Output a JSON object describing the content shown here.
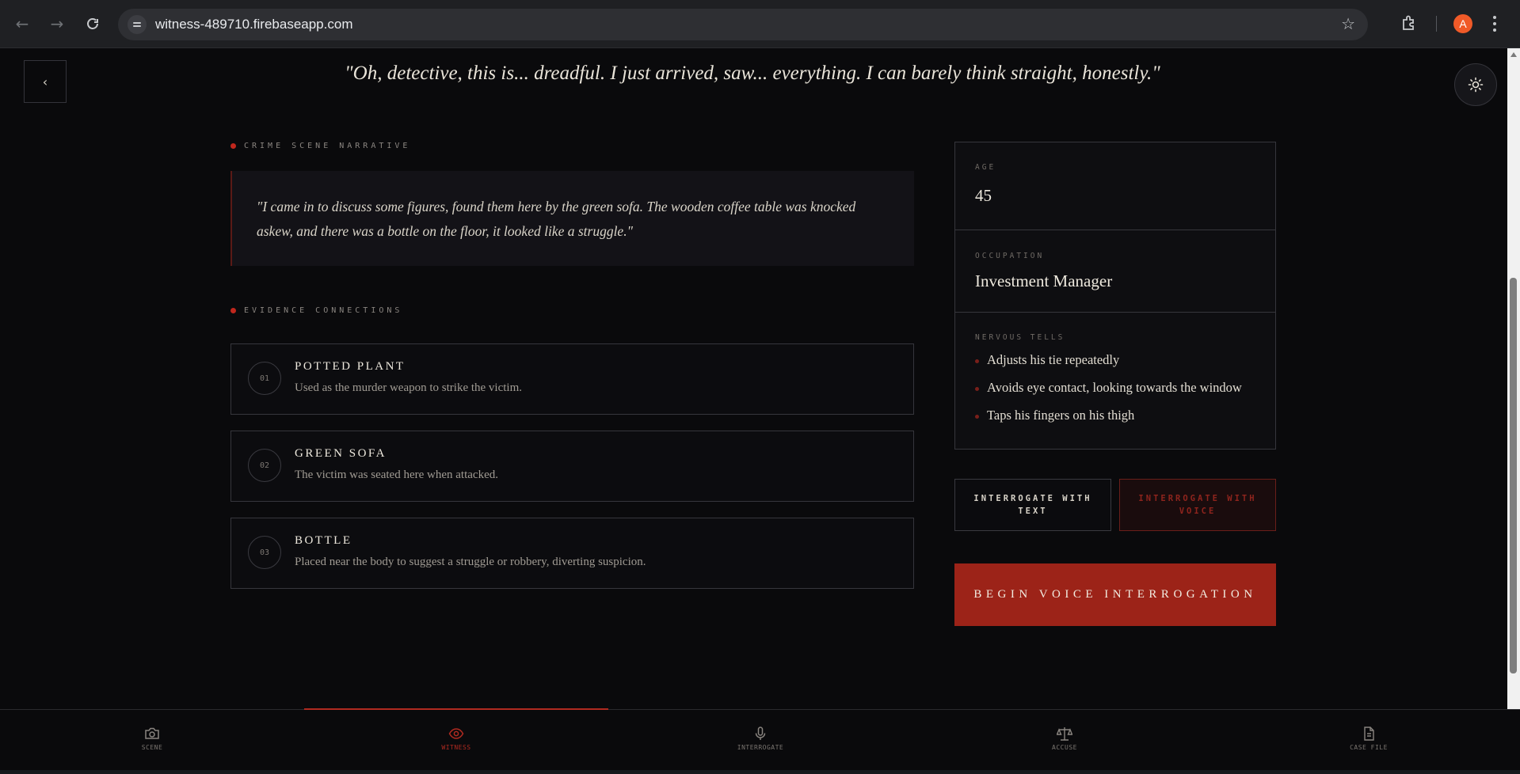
{
  "browser": {
    "url": "witness-489710.firebaseapp.com",
    "avatar_letter": "A"
  },
  "page": {
    "quote": "\"Oh, detective, this is... dreadful. I just arrived, saw... everything. I can barely think straight, honestly.\"",
    "back_icon": "chevron-left-icon",
    "theme_icon": "sun-icon"
  },
  "narrative": {
    "label": "CRIME SCENE NARRATIVE",
    "text": "\"I came in to discuss some figures, found them here by the green sofa. The wooden coffee table was knocked askew, and there was a bottle on the floor, it looked like a struggle.\""
  },
  "evidence": {
    "label": "EVIDENCE CONNECTIONS",
    "items": [
      {
        "num": "01",
        "title": "POTTED PLANT",
        "desc": "Used as the murder weapon to strike the victim."
      },
      {
        "num": "02",
        "title": "GREEN SOFA",
        "desc": "The victim was seated here when attacked."
      },
      {
        "num": "03",
        "title": "BOTTLE",
        "desc": "Placed near the body to suggest a struggle or robbery, diverting suspicion."
      }
    ]
  },
  "profile": {
    "age_label": "AGE",
    "age": "45",
    "occupation_label": "OCCUPATION",
    "occupation": "Investment Manager",
    "tells_label": "NERVOUS TELLS",
    "tells": [
      "Adjusts his tie repeatedly",
      "Avoids eye contact, looking towards the window",
      "Taps his fingers on his thigh"
    ]
  },
  "actions": {
    "text_mode": "INTERROGATE WITH TEXT",
    "voice_mode": "INTERROGATE WITH VOICE",
    "begin": "BEGIN VOICE INTERROGATION"
  },
  "bottom_nav": [
    {
      "label": "SCENE",
      "icon": "camera-icon",
      "active": false
    },
    {
      "label": "WITNESS",
      "icon": "eye-icon",
      "active": true
    },
    {
      "label": "INTERROGATE",
      "icon": "microphone-icon",
      "active": false
    },
    {
      "label": "ACCUSE",
      "icon": "scales-icon",
      "active": false
    },
    {
      "label": "CASE FILE",
      "icon": "document-icon",
      "active": false
    }
  ],
  "colors": {
    "accent": "#b02a20",
    "background": "#0a0a0c",
    "begin_button": "#9c2318"
  }
}
